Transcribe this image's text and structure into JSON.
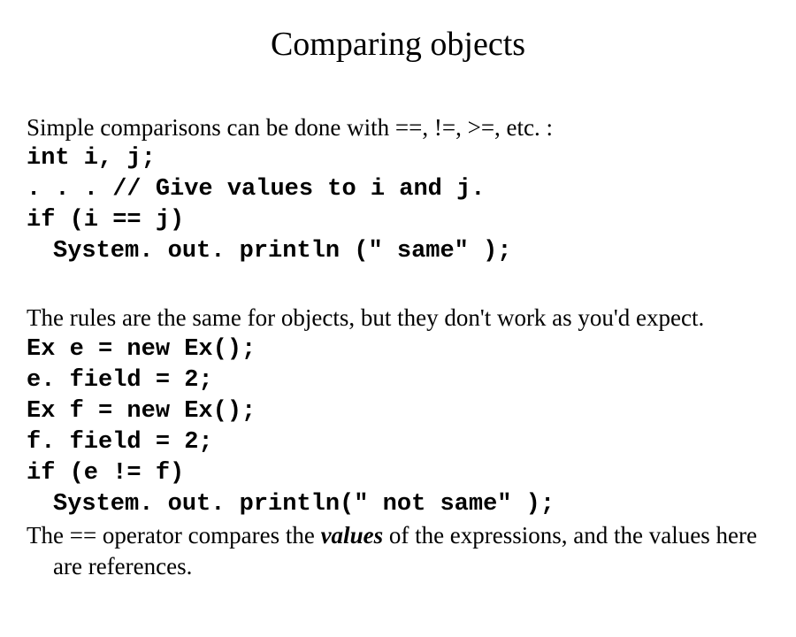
{
  "title": "Comparing objects",
  "p1": {
    "intro": "Simple comparisons can be done with ==, !=, >=, etc. :",
    "code1": "int i, j;",
    "code2": ". . . // Give values to i and j.",
    "code3": "if (i == j)",
    "code4": "System. out. println (\" same\" );"
  },
  "p2": {
    "intro": "The rules are the same for objects, but they don't work as you'd expect.",
    "code1": "Ex e = new Ex();",
    "code2": "e. field = 2;",
    "code3": "Ex f = new Ex();",
    "code4": "f. field = 2;",
    "code5": "if (e != f)",
    "code6": "System. out. println(\" not same\" );",
    "footer_a": "The == operator compares the ",
    "footer_em": "values",
    "footer_b": " of the expressions, and the values here",
    "footer_c": "are references."
  }
}
